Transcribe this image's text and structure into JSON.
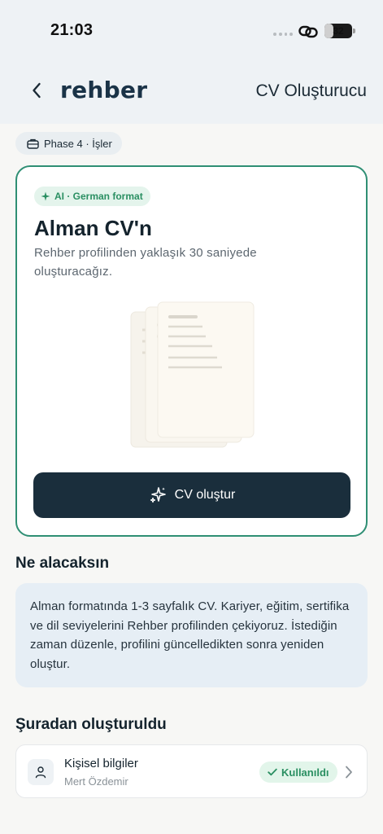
{
  "status": {
    "time": "21:03",
    "battery": "32",
    "battery_level": 0.32
  },
  "header": {
    "logo": "rehber",
    "title": "CV Oluşturucu"
  },
  "phase_pill": {
    "label": "Phase 4 · İşler"
  },
  "card": {
    "badge": "AI · German format",
    "title": "Alman CV'n",
    "description": "Rehber profilinden yaklaşık 30 saniyede oluşturacağız.",
    "button_label": "CV oluştur"
  },
  "what_you_get": {
    "title": "Ne alacaksın",
    "text": "Alman formatında 1-3 sayfalık CV. Kariyer, eğitim, sertifika ve dil seviyelerini Rehber profilinden çekiyoruz. İstediğin zaman düzenle, profilini güncelledikten sonra yeniden oluştur."
  },
  "sources": {
    "title": "Şuradan oluşturuldu",
    "items": [
      {
        "title": "Kişisel bilgiler",
        "subtitle": "Mert Özdemir",
        "badge": "Kullanıldı",
        "icon": "person-icon"
      }
    ]
  },
  "colors": {
    "accent": "#2f8f74",
    "dark_button": "#1a2e3c",
    "logo": "#1a3347",
    "success": "#2a8f62",
    "info_bg": "#e6eef5"
  }
}
